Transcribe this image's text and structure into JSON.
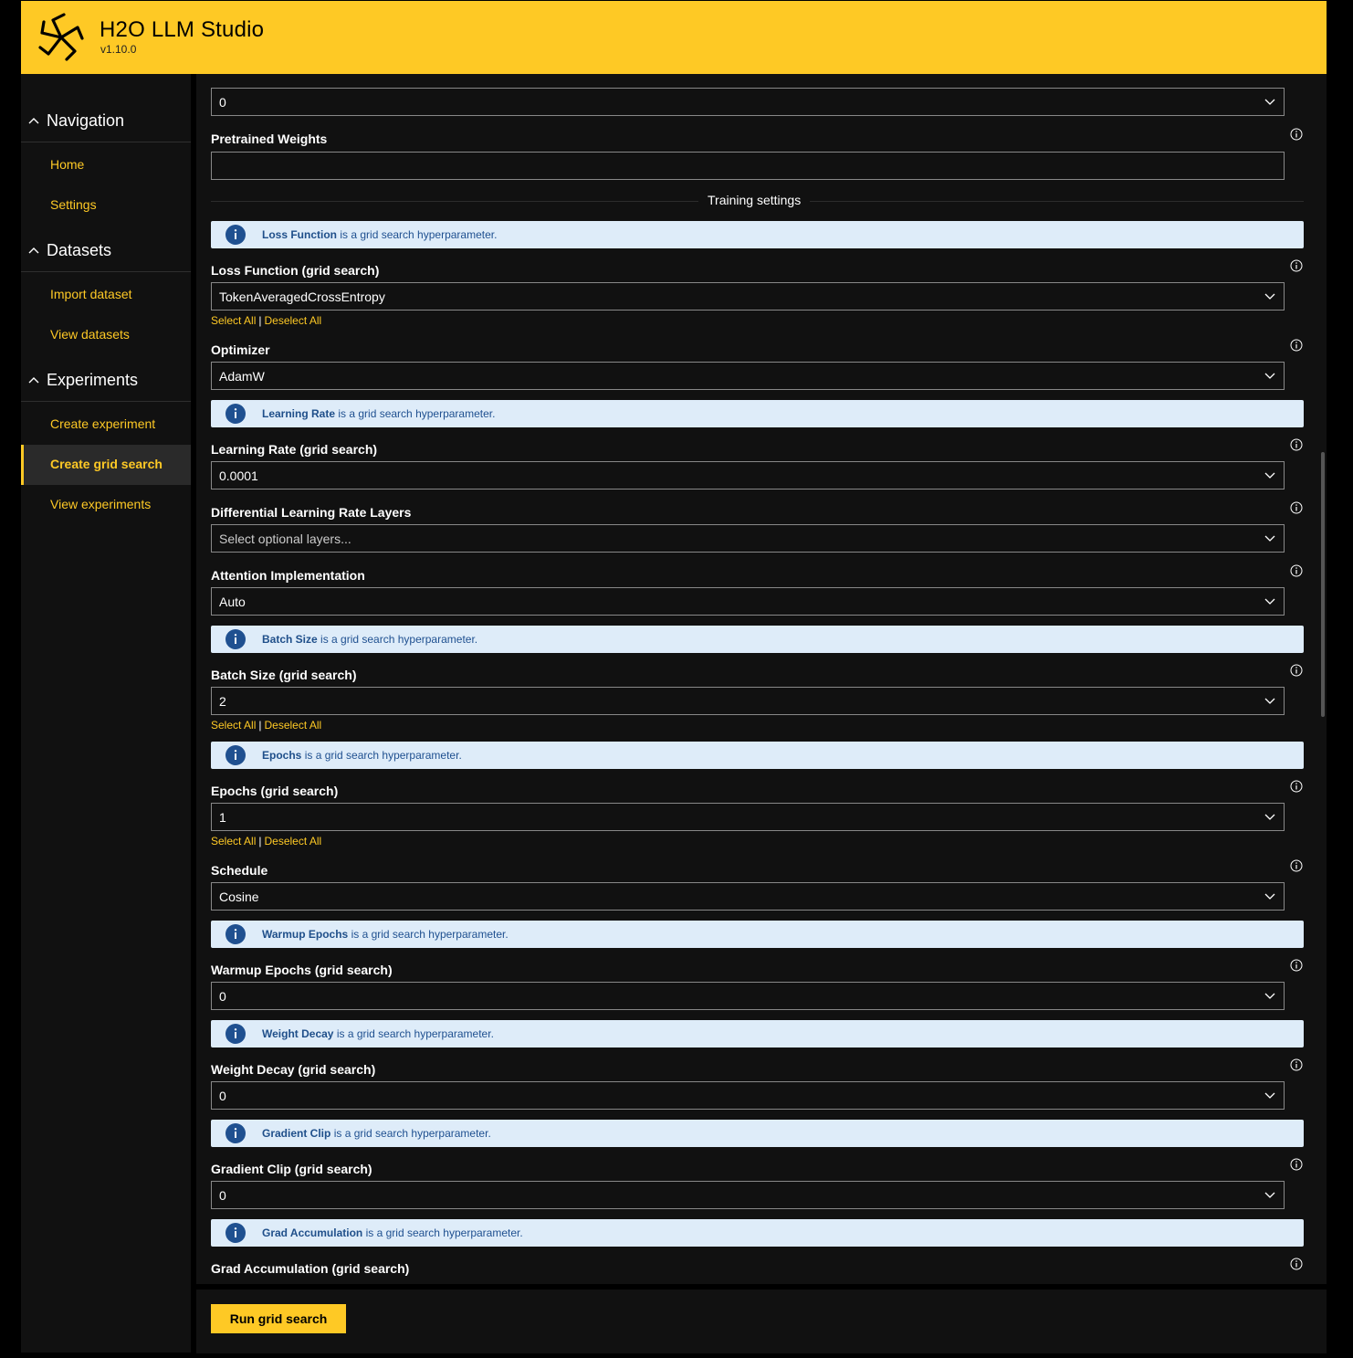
{
  "app": {
    "title": "H2O LLM Studio",
    "version": "v1.10.0"
  },
  "colors": {
    "brand": "#fec925",
    "background": "#111111",
    "info_bar": "#deecf9",
    "info_text": "#1f5090"
  },
  "sidebar": {
    "groups": [
      {
        "label": "Navigation",
        "items": [
          {
            "label": "Home"
          },
          {
            "label": "Settings"
          }
        ]
      },
      {
        "label": "Datasets",
        "items": [
          {
            "label": "Import dataset"
          },
          {
            "label": "View datasets"
          }
        ]
      },
      {
        "label": "Experiments",
        "items": [
          {
            "label": "Create experiment"
          },
          {
            "label": "Create grid search",
            "active": true
          },
          {
            "label": "View experiments"
          }
        ]
      }
    ]
  },
  "form": {
    "top_select_value": "0",
    "pretrained_weights": {
      "label": "Pretrained Weights",
      "value": ""
    },
    "section_title": "Training settings",
    "info_suffix": "is a grid search hyperparameter.",
    "select_all": "Select All",
    "deselect_all": "Deselect All",
    "fields": [
      {
        "info_name": "Loss Function",
        "label": "Loss Function (grid search)",
        "value": "TokenAveragedCrossEntropy"
      },
      {
        "label": "Optimizer",
        "value": "AdamW"
      },
      {
        "info_name": "Learning Rate",
        "label": "Learning Rate (grid search)",
        "value": "0.0001"
      },
      {
        "label": "Differential Learning Rate Layers",
        "placeholder": "Select optional layers..."
      },
      {
        "label": "Attention Implementation",
        "value": "Auto"
      },
      {
        "info_name": "Batch Size",
        "label": "Batch Size (grid search)",
        "value": "2"
      },
      {
        "info_name": "Epochs",
        "label": "Epochs (grid search)",
        "value": "1"
      },
      {
        "label": "Schedule",
        "value": "Cosine"
      },
      {
        "info_name": "Warmup Epochs",
        "label": "Warmup Epochs (grid search)",
        "value": "0"
      },
      {
        "info_name": "Weight Decay",
        "label": "Weight Decay (grid search)",
        "value": "0"
      },
      {
        "info_name": "Gradient Clip",
        "label": "Gradient Clip (grid search)",
        "value": "0"
      },
      {
        "info_name": "Grad Accumulation",
        "label": "Grad Accumulation (grid search)"
      }
    ]
  },
  "footer": {
    "run_button": "Run grid search"
  }
}
